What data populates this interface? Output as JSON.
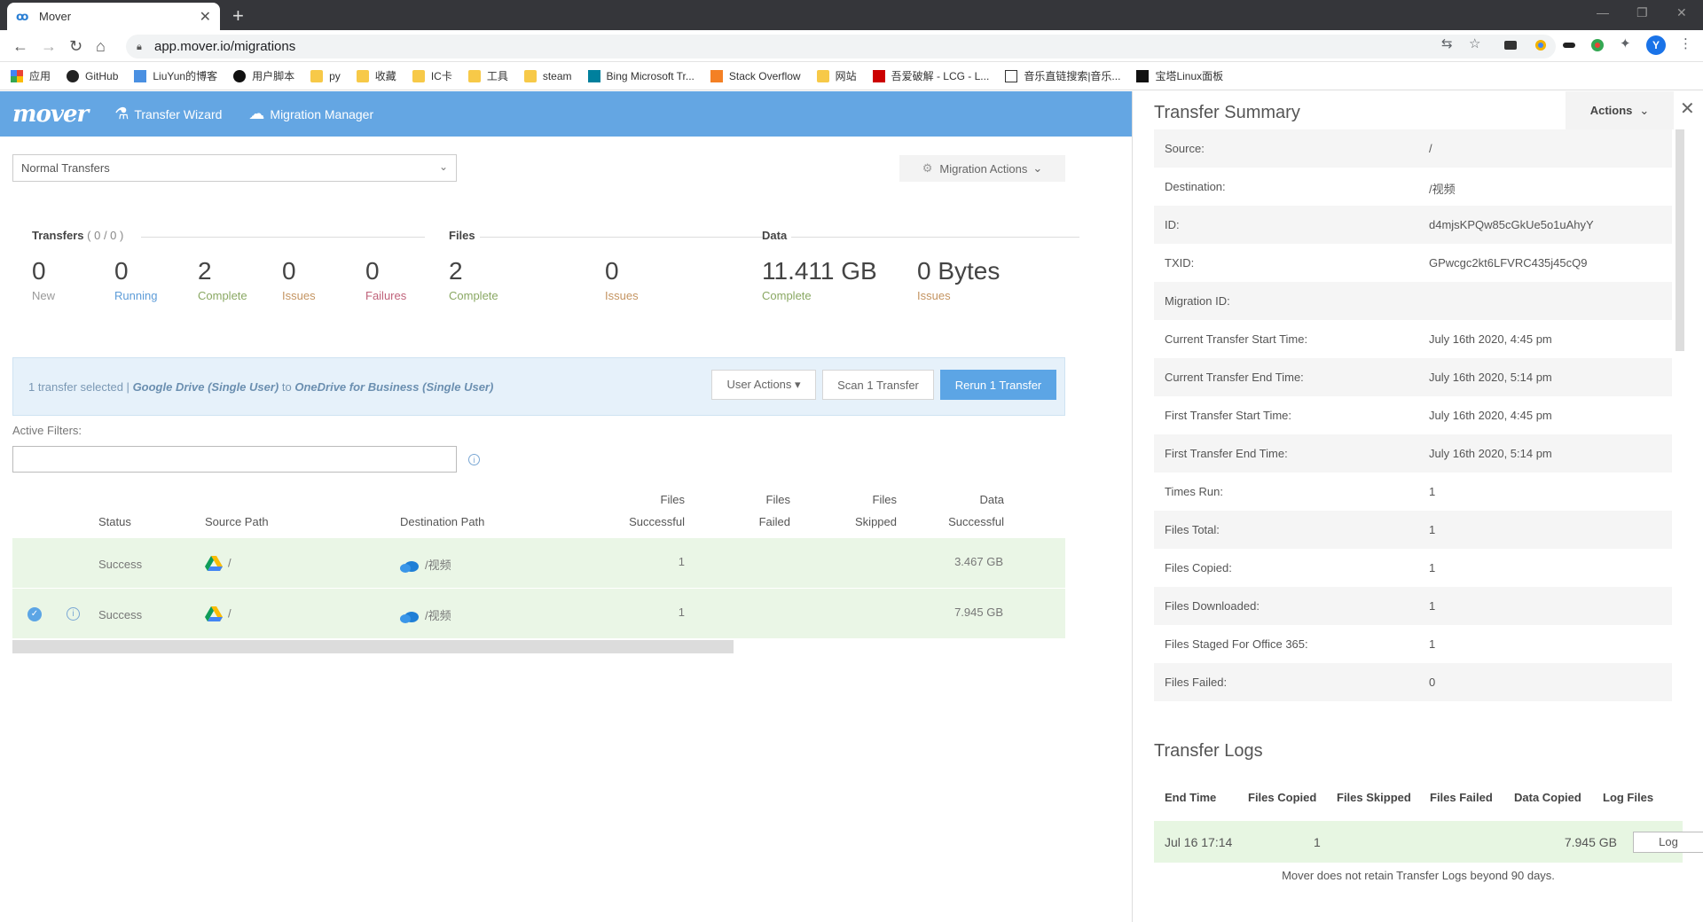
{
  "browser": {
    "tab_title": "Mover",
    "url": "app.mover.io/migrations",
    "profile_initial": "Y",
    "bookmarks": [
      "应用",
      "GitHub",
      "LiuYun的博客",
      "用户脚本",
      "py",
      "收藏",
      "IC卡",
      "工具",
      "steam",
      "Bing Microsoft Tr...",
      "Stack Overflow",
      "网站",
      "吾爱破解 - LCG - L...",
      "音乐直链搜索|音乐...",
      "宝塔Linux面板"
    ]
  },
  "app": {
    "logo": "mover",
    "nav": {
      "wizard": "Transfer Wizard",
      "manager": "Migration Manager"
    }
  },
  "filter": {
    "select_value": "Normal Transfers",
    "migration_actions": "Migration Actions"
  },
  "stats": {
    "transfers_label": "Transfers",
    "transfers_count": "( 0 / 0 )",
    "files_label": "Files",
    "data_label": "Data",
    "items": [
      {
        "value": "0",
        "label": "New"
      },
      {
        "value": "0",
        "label": "Running"
      },
      {
        "value": "2",
        "label": "Complete"
      },
      {
        "value": "0",
        "label": "Issues"
      },
      {
        "value": "0",
        "label": "Failures"
      },
      {
        "value": "2",
        "label": "Complete"
      },
      {
        "value": "0",
        "label": "Issues"
      },
      {
        "value": "11.411 GB",
        "label": "Complete"
      },
      {
        "value": "0 Bytes",
        "label": "Issues"
      }
    ]
  },
  "selection": {
    "prefix": "1 transfer selected |",
    "source": "Google Drive (Single User)",
    "to": "to",
    "dest": "OneDrive for Business (Single User)",
    "user_actions": "User Actions ▾",
    "scan": "Scan 1 Transfer",
    "rerun": "Rerun 1 Transfer"
  },
  "active_filters": {
    "label": "Active Filters:",
    "value": ""
  },
  "table": {
    "headers": {
      "status": "Status",
      "source": "Source Path",
      "dest": "Destination Path",
      "files_succ_1": "Files",
      "files_succ_2": "Successful",
      "files_failed_1": "Files",
      "files_failed_2": "Failed",
      "files_skipped_1": "Files",
      "files_skipped_2": "Skipped",
      "data_succ_1": "Data",
      "data_succ_2": "Successful"
    },
    "rows": [
      {
        "status": "Success",
        "source": "/",
        "dest": "/视频",
        "files_successful": "1",
        "files_failed": "",
        "files_skipped": "",
        "data_successful": "3.467 GB"
      },
      {
        "status": "Success",
        "source": "/",
        "dest": "/视频",
        "files_successful": "1",
        "files_failed": "",
        "files_skipped": "",
        "data_successful": "7.945 GB"
      }
    ]
  },
  "panel": {
    "title": "Transfer Summary",
    "actions": "Actions",
    "summary": [
      {
        "k": "Source:",
        "v": "/"
      },
      {
        "k": "Destination:",
        "v": "/视频"
      },
      {
        "k": "ID:",
        "v": "d4mjsKPQw85cGkUe5o1uAhyY"
      },
      {
        "k": "TXID:",
        "v": "GPwcgc2kt6LFVRC435j45cQ9"
      },
      {
        "k": "Migration ID:",
        "v": ""
      },
      {
        "k": "Current Transfer Start Time:",
        "v": "July 16th 2020, 4:45 pm"
      },
      {
        "k": "Current Transfer End Time:",
        "v": "July 16th 2020, 5:14 pm"
      },
      {
        "k": "First Transfer Start Time:",
        "v": "July 16th 2020, 4:45 pm"
      },
      {
        "k": "First Transfer End Time:",
        "v": "July 16th 2020, 5:14 pm"
      },
      {
        "k": "Times Run:",
        "v": "1"
      },
      {
        "k": "Files Total:",
        "v": "1"
      },
      {
        "k": "Files Copied:",
        "v": "1"
      },
      {
        "k": "Files Downloaded:",
        "v": "1"
      },
      {
        "k": "Files Staged For Office 365:",
        "v": "1"
      },
      {
        "k": "Files Failed:",
        "v": "0"
      }
    ],
    "logs_title": "Transfer Logs",
    "log_headers": [
      "End Time",
      "Files Copied",
      "Files Skipped",
      "Files Failed",
      "Data Copied",
      "Log Files"
    ],
    "log_row": {
      "end_time": "Jul 16 17:14",
      "files_copied": "1",
      "files_skipped": "",
      "files_failed": "",
      "data_copied": "7.945 GB",
      "log_button": "Log"
    },
    "retention_note": "Mover does not retain Transfer Logs beyond 90 days."
  }
}
